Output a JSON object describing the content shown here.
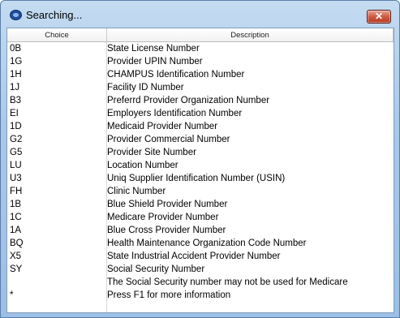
{
  "window": {
    "title": "Searching...",
    "close_glyph": "✕",
    "app_icon": "eye-icon"
  },
  "table": {
    "columns": {
      "choice": "Choice",
      "description": "Description"
    },
    "rows": [
      {
        "choice": "0B",
        "description": "State License Number"
      },
      {
        "choice": "1G",
        "description": "Provider UPIN Number"
      },
      {
        "choice": "1H",
        "description": "CHAMPUS  Identification Number"
      },
      {
        "choice": "1J",
        "description": "Facility ID Number"
      },
      {
        "choice": "B3",
        "description": "Preferrd Provider Organization Number"
      },
      {
        "choice": "EI",
        "description": "Employers Identification Number"
      },
      {
        "choice": "1D",
        "description": "Medicaid Provider Number"
      },
      {
        "choice": "G2",
        "description": "Provider Commercial Number"
      },
      {
        "choice": "G5",
        "description": "Provider Site Number"
      },
      {
        "choice": "LU",
        "description": "Location Number"
      },
      {
        "choice": "U3",
        "description": "Uniq Supplier Identification Number (USIN)"
      },
      {
        "choice": "FH",
        "description": "Clinic Number"
      },
      {
        "choice": "1B",
        "description": "Blue Shield Provider Number"
      },
      {
        "choice": "1C",
        "description": "Medicare Provider Number"
      },
      {
        "choice": "1A",
        "description": "Blue Cross Provider Number"
      },
      {
        "choice": "BQ",
        "description": "Health Maintenance Organization Code Number"
      },
      {
        "choice": "X5",
        "description": "State Industrial Accident Provider Number"
      },
      {
        "choice": "SY",
        "description": "Social Security Number"
      },
      {
        "choice": "",
        "description": "The Social Security number may not be used for Medicare"
      },
      {
        "choice": "*",
        "description": "Press F1 for more information"
      }
    ]
  }
}
